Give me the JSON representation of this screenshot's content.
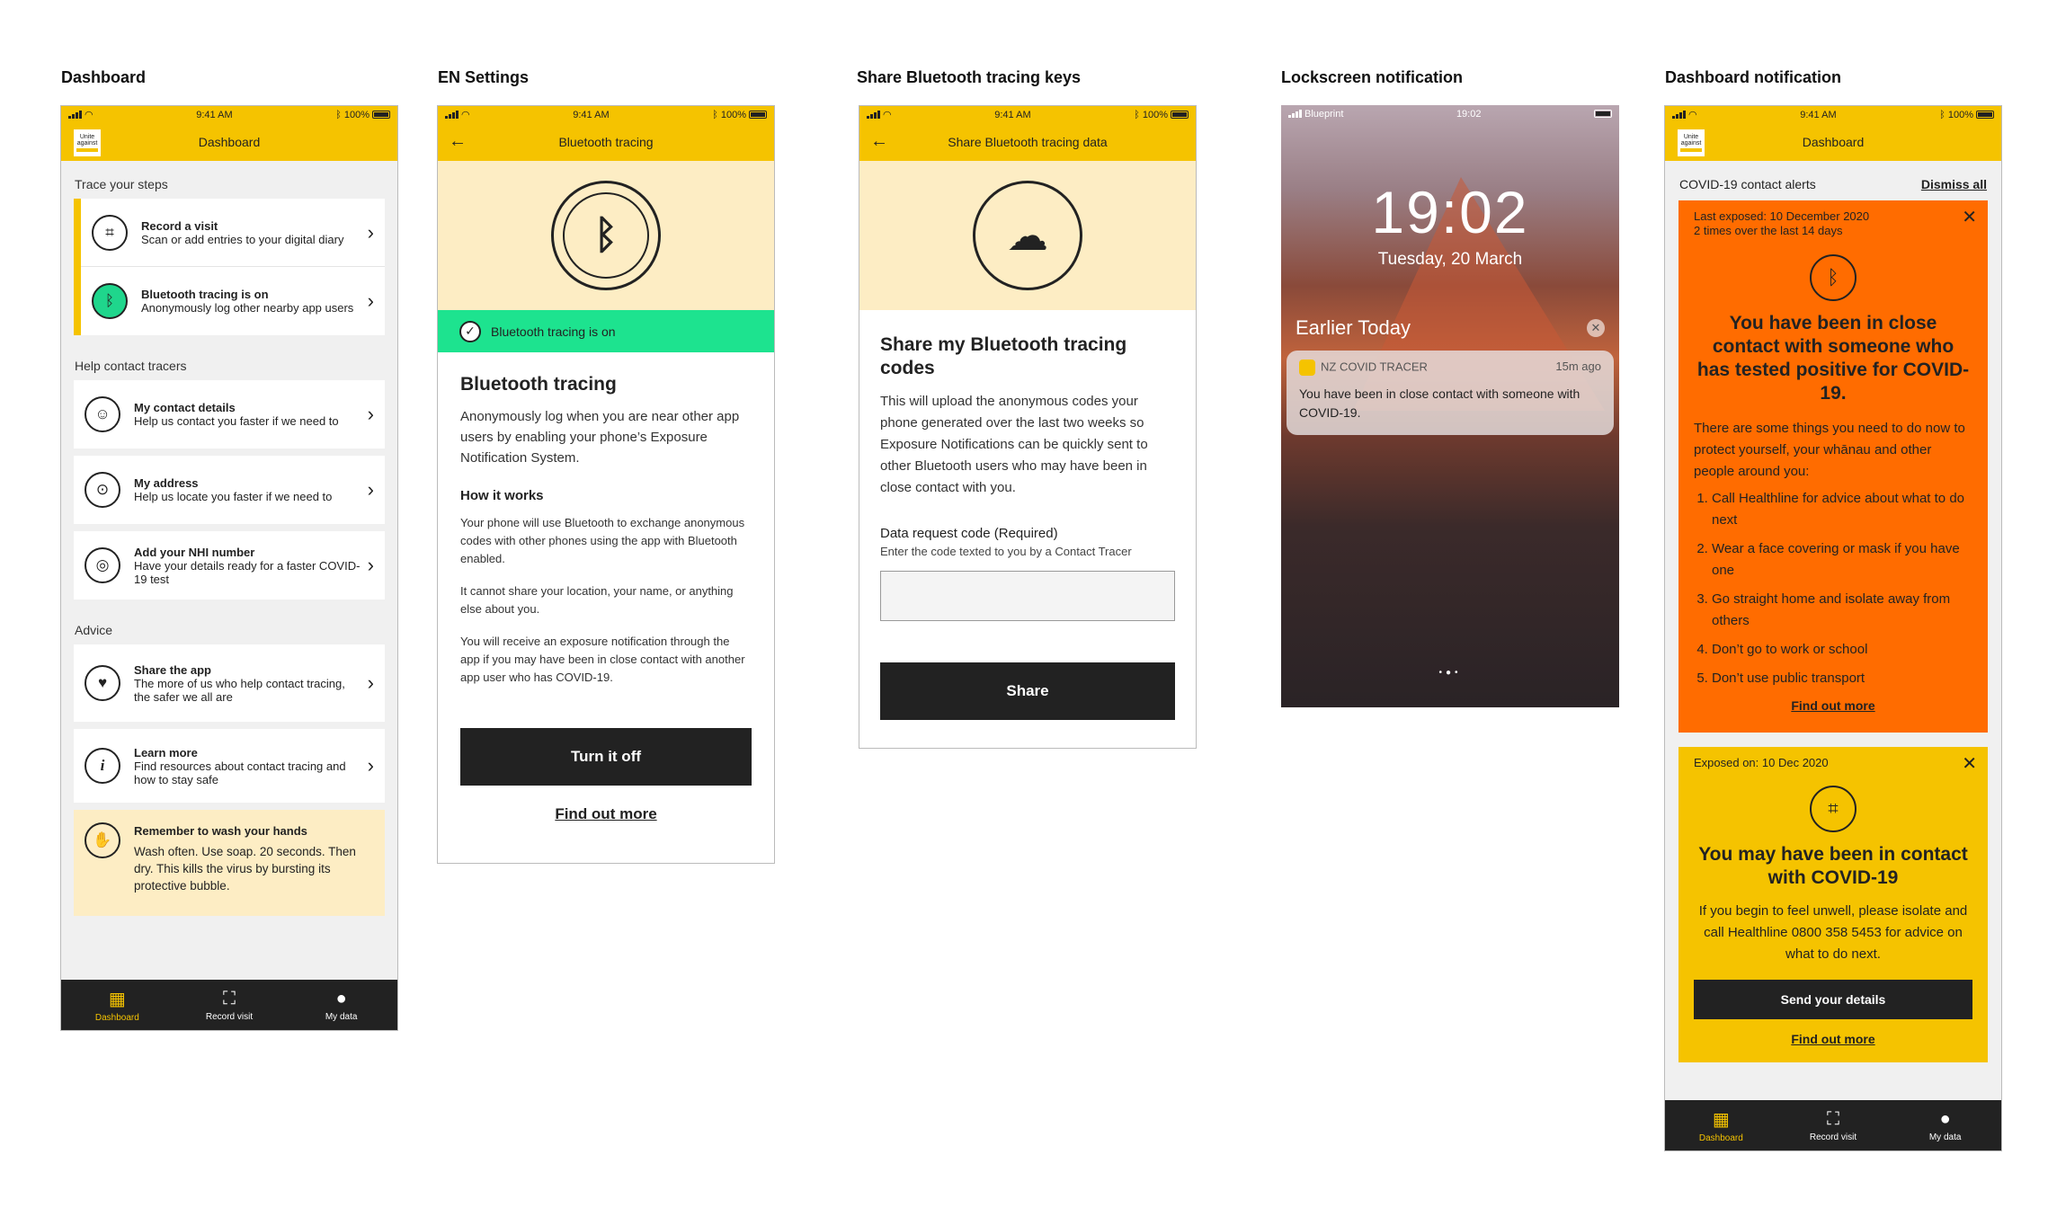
{
  "screens": {
    "dashboard": "Dashboard",
    "en_settings": "EN Settings",
    "share_keys": "Share Bluetooth tracing keys",
    "lockscreen": "Lockscreen notification",
    "dash_notif": "Dashboard notification"
  },
  "status": {
    "time": "9:41 AM",
    "battery": "100%",
    "lock_carrier": "Blueprint",
    "lock_time": "19:02"
  },
  "logo": {
    "line1": "Unite",
    "line2": "against",
    "line3": "COVID-19"
  },
  "dashboard": {
    "header": "Dashboard",
    "trace_title": "Trace your steps",
    "record": {
      "title": "Record a visit",
      "desc": "Scan or add entries to your digital diary"
    },
    "bt": {
      "title": "Bluetooth tracing is on",
      "desc": "Anonymously log other nearby app users"
    },
    "help_title": "Help contact tracers",
    "contact": {
      "title": "My contact details",
      "desc": "Help us contact you faster if we need to"
    },
    "address": {
      "title": "My address",
      "desc": "Help us locate you faster if we need to"
    },
    "nhi": {
      "title": "Add your NHI number",
      "desc": "Have your details ready for a faster COVID-19 test"
    },
    "advice_title": "Advice",
    "share": {
      "title": "Share the app",
      "desc": "The more of us who help contact tracing, the safer we all are"
    },
    "learn": {
      "title": "Learn more",
      "desc": "Find resources about contact tracing and how to stay safe"
    },
    "wash": {
      "title": "Remember to wash your hands",
      "desc": "Wash often. Use soap. 20 seconds. Then dry. This kills the virus by bursting its protective bubble."
    }
  },
  "tabs": {
    "dashboard": "Dashboard",
    "record": "Record visit",
    "mydata": "My data"
  },
  "en": {
    "header": "Bluetooth tracing",
    "status": "Bluetooth tracing is on",
    "h": "Bluetooth tracing",
    "intro": "Anonymously log when you are near other app users by enabling your phone’s Exposure Notification System.",
    "how": "How it works",
    "p1": "Your phone will use Bluetooth to exchange anonymous codes with other phones using the app with Bluetooth enabled.",
    "p2": "It cannot share your location, your name, or anything else about you.",
    "p3": "You will receive an exposure notification through the app if you may have been in close contact with another app user who has COVID-19.",
    "btn": "Turn it off",
    "link": "Find out more"
  },
  "share": {
    "header": "Share Bluetooth tracing data",
    "h": "Share my Bluetooth tracing codes",
    "body": "This will upload the anonymous codes your phone generated over the last two weeks so Exposure Notifications can be quickly sent to other Bluetooth users who may have been in close contact with you.",
    "label": "Data request code (Required)",
    "hint": "Enter the code texted to you by a Contact Tracer",
    "btn": "Share"
  },
  "lock": {
    "clock": "19:02",
    "date": "Tuesday, 20 March",
    "earlier": "Earlier Today",
    "app": "NZ COVID TRACER",
    "ago": "15m ago",
    "msg": "You have been in close contact with someone with COVID-19."
  },
  "dnotif": {
    "header": "Dashboard",
    "alerts": "COVID-19 contact alerts",
    "dismiss": "Dismiss all",
    "o_meta1": "Last exposed: 10 December 2020",
    "o_meta2": "2 times over the last 14 days",
    "o_h": "You have been in close contact with someone who has tested positive for COVID-19.",
    "o_p": "There are some things you need to do now to protect yourself, your whānau and other people around you:",
    "o_list": [
      "Call Healthline for advice about what to do next",
      "Wear a face covering or mask if you have one",
      "Go straight home and isolate away from others",
      "Don’t go to work or school",
      "Don’t use public transport"
    ],
    "o_link": "Find out more",
    "y_meta": "Exposed on: 10 Dec 2020",
    "y_h": "You may have been in contact with COVID-19",
    "y_p": "If you begin to feel unwell, please isolate and call Healthline 0800 358 5453 for advice on what to do next.",
    "y_btn": "Send your details",
    "y_link": "Find out more"
  }
}
